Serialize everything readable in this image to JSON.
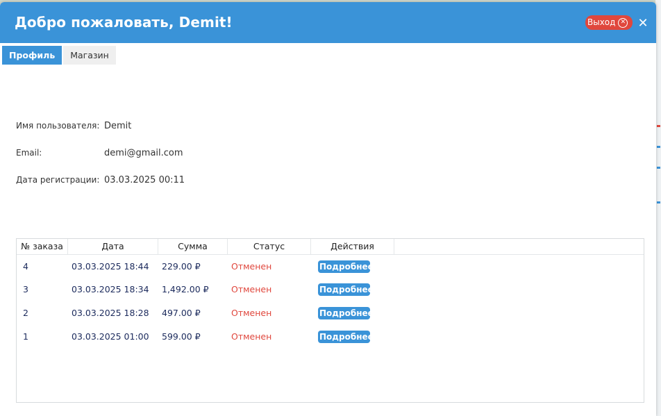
{
  "header": {
    "title": "Добро пожаловать, Demit!",
    "logout_label": "Выход"
  },
  "tabs": [
    {
      "label": "Профиль"
    },
    {
      "label": "Магазин"
    }
  ],
  "profile": {
    "username_label": "Имя пользователя:",
    "username": "Demit",
    "email_label": "Email:",
    "email": "demi@gmail.com",
    "regdate_label": "Дата регистрации:",
    "regdate": "03.03.2025 00:11"
  },
  "orders": {
    "columns": [
      "№ заказа",
      "Дата",
      "Сумма",
      "Статус",
      "Действия"
    ],
    "rows": [
      {
        "id": "4",
        "date": "03.03.2025 18:44",
        "sum": "229.00 ₽",
        "status": "Отменен",
        "action": "Подробнее"
      },
      {
        "id": "3",
        "date": "03.03.2025 18:34",
        "sum": "1,492.00 ₽",
        "status": "Отменен",
        "action": "Подробнее"
      },
      {
        "id": "2",
        "date": "03.03.2025 18:28",
        "sum": "497.00 ₽",
        "status": "Отменен",
        "action": "Подробнее"
      },
      {
        "id": "1",
        "date": "03.03.2025 01:00",
        "sum": "599.00 ₽",
        "status": "Отменен",
        "action": "Подробнее"
      }
    ]
  },
  "colors": {
    "accent": "#3a93d8",
    "danger": "#e0473d",
    "table_text": "#1b2a5c"
  }
}
